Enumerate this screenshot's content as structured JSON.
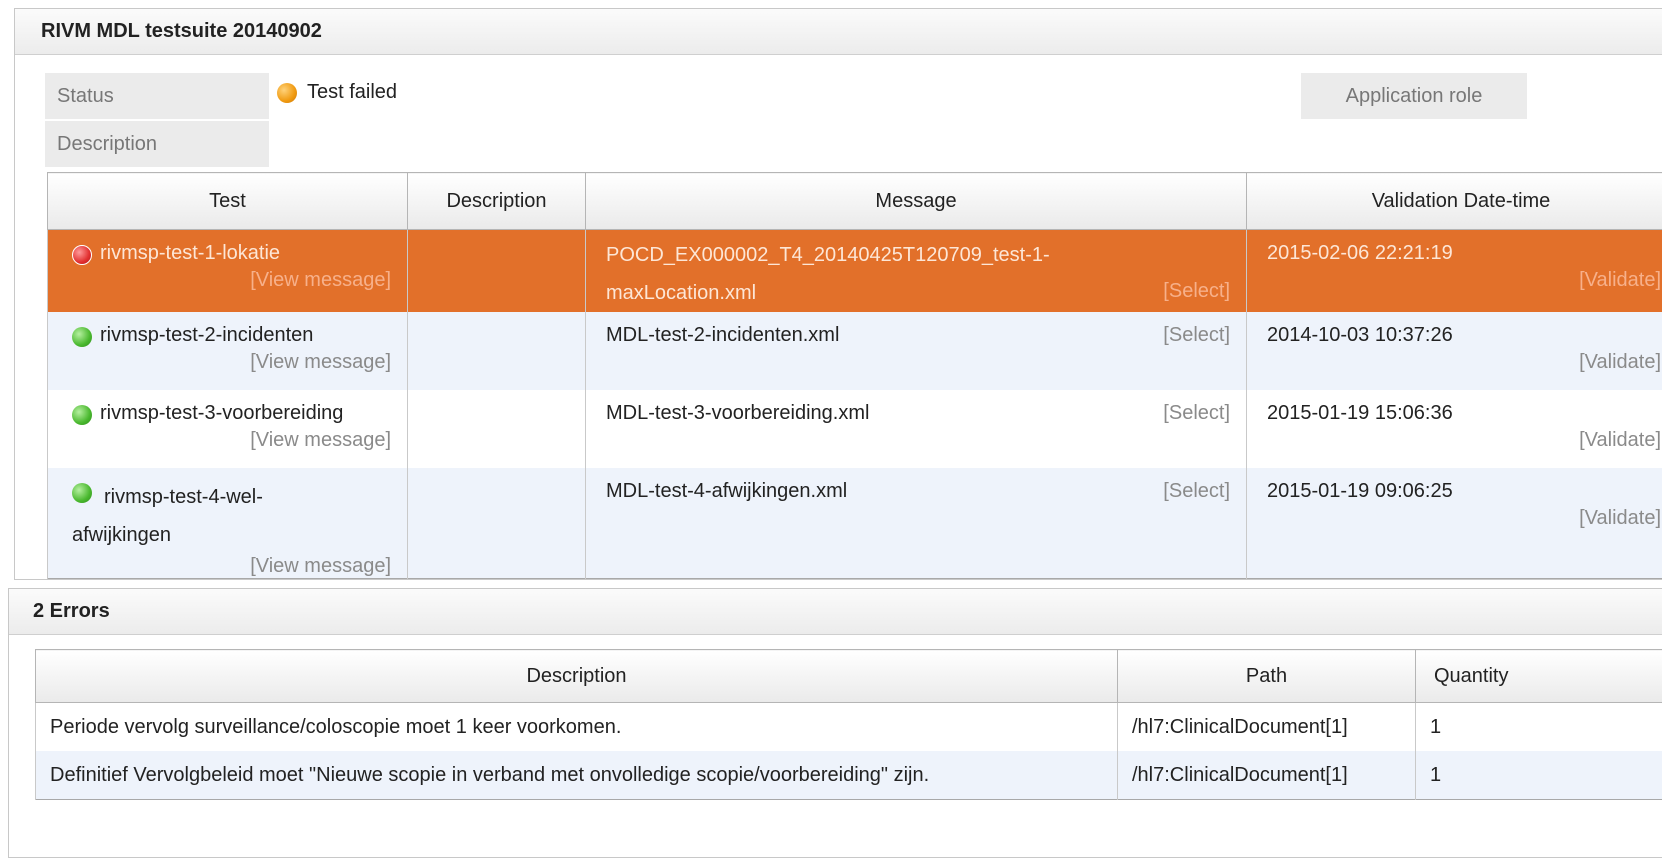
{
  "suite_panel": {
    "title": "RIVM MDL testsuite 20140902",
    "status_label": "Status",
    "status_value": "Test failed",
    "description_label": "Description",
    "application_role_label": "Application role"
  },
  "tests_table": {
    "columns": [
      "Test",
      "Description",
      "Message",
      "Validation Date-time"
    ],
    "view_message_label": "[View message]",
    "select_label": "[Select]",
    "validate_label": "[Validate]",
    "rows": [
      {
        "name": "rivmsp-test-1-lokatie",
        "status": "failed",
        "description": "",
        "message": "POCD_EX000002_T4_20140425T120709_test-1-maxLocation.xml",
        "datetime": "2015-02-06 22:21:19"
      },
      {
        "name": "rivmsp-test-2-incidenten",
        "status": "passed",
        "description": "",
        "message": "MDL-test-2-incidenten.xml",
        "datetime": "2014-10-03 10:37:26"
      },
      {
        "name": "rivmsp-test-3-voorbereiding",
        "status": "passed",
        "description": "",
        "message": "MDL-test-3-voorbereiding.xml",
        "datetime": "2015-01-19 15:06:36"
      },
      {
        "name": "rivmsp-test-4-wel-afwijkingen",
        "status": "passed",
        "description": "",
        "message": "MDL-test-4-afwijkingen.xml",
        "datetime": "2015-01-19 09:06:25"
      }
    ]
  },
  "errors_panel": {
    "title": "2 Errors",
    "columns": [
      "Description",
      "Path",
      "Quantity"
    ],
    "rows": [
      {
        "description": "Periode vervolg surveillance/coloscopie moet 1 keer voorkomen.",
        "path": "/hl7:ClinicalDocument[1]",
        "quantity": "1"
      },
      {
        "description": "Definitief Vervolgbeleid moet \"Nieuwe scopie in verband met onvolledige scopie/voorbereiding\" zijn.",
        "path": "/hl7:ClinicalDocument[1]",
        "quantity": "1"
      }
    ]
  },
  "colors": {
    "selected_row": "#e2702a",
    "alt_row": "#eef3fb",
    "status_failed": "#f09a10",
    "test_failed": "#e23030",
    "test_passed": "#49b82e"
  },
  "icons": {
    "status": "orange-status-dot-icon",
    "failed": "red-status-dot-icon",
    "passed": "green-status-dot-icon"
  }
}
